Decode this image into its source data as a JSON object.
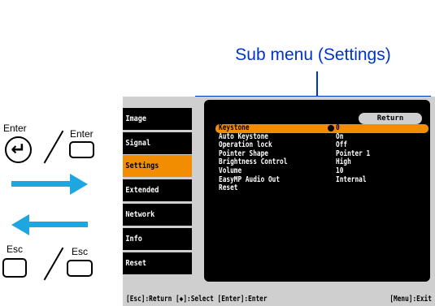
{
  "callout": {
    "label": "Sub menu (Settings)"
  },
  "legend": {
    "enter_label_1": "Enter",
    "enter_label_2": "Enter",
    "esc_label_1": "Esc",
    "esc_label_2": "Esc",
    "enter_glyph": "↵"
  },
  "sidebar": {
    "items": [
      {
        "label": "Image"
      },
      {
        "label": "Signal"
      },
      {
        "label": "Settings"
      },
      {
        "label": "Extended"
      },
      {
        "label": "Network"
      },
      {
        "label": "Info"
      },
      {
        "label": "Reset"
      }
    ],
    "active": "Settings"
  },
  "panel": {
    "return_label": "Return",
    "rows": [
      {
        "label": "Keystone",
        "value": "0"
      },
      {
        "label": "Auto Keystone",
        "value": "On"
      },
      {
        "label": "Operation lock",
        "value": "Off"
      },
      {
        "label": "Pointer Shape",
        "value": "Pointer 1"
      },
      {
        "label": "Brightness Control",
        "value": "High"
      },
      {
        "label": "Volume",
        "value": "10"
      },
      {
        "label": "EasyMP Audio Out",
        "value": "Internal"
      },
      {
        "label": "Reset",
        "value": ""
      }
    ]
  },
  "status_bar": {
    "left": "[Esc]:Return [◆]:Select [Enter]:Enter",
    "right": "[Menu]:Exit"
  },
  "colors": {
    "accent": "#f28c00",
    "callout": "#0033cc",
    "arrow": "#1ea6e0",
    "panel_bg": "#000000",
    "frame_bg": "#cfcfcf"
  }
}
